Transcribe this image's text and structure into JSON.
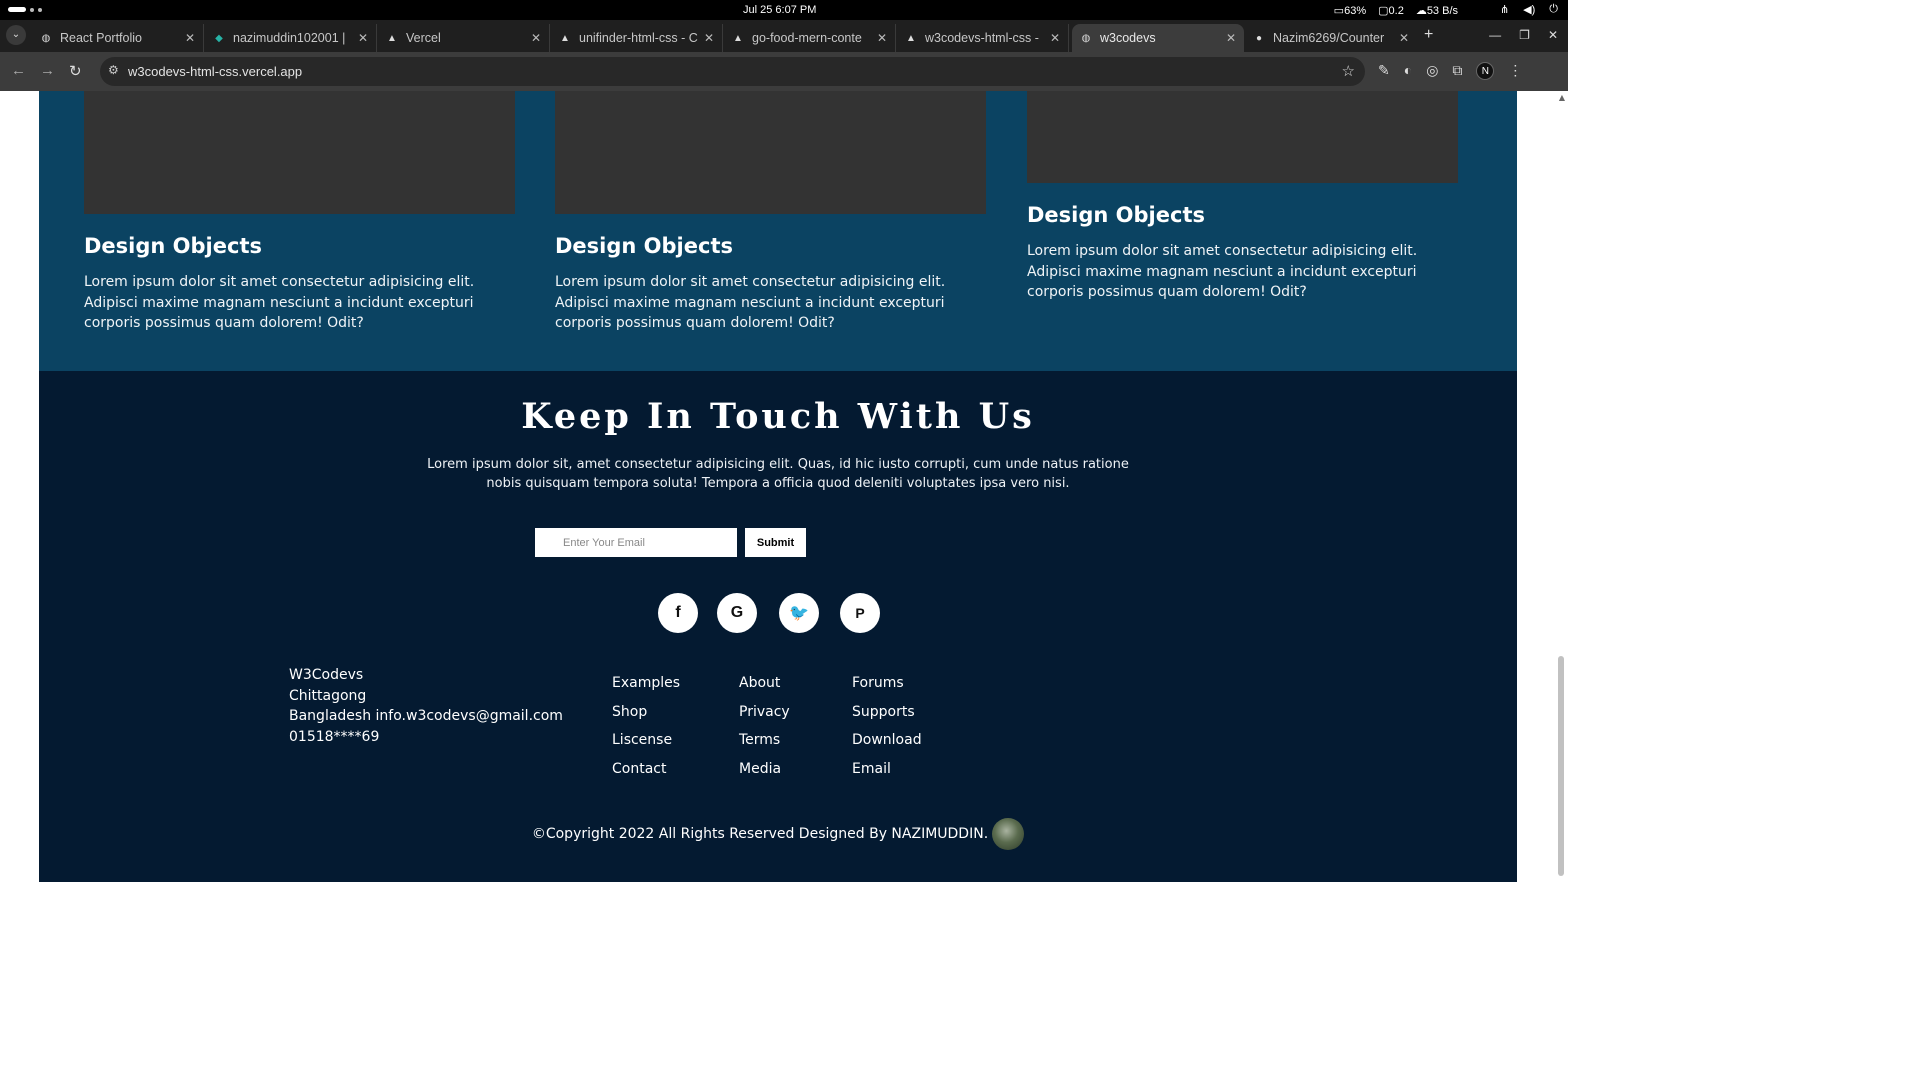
{
  "os": {
    "clock": "Jul 25   6:07 PM",
    "battery": "63%",
    "cpu": "0.2",
    "network": "53 B/s"
  },
  "browser": {
    "tabs": [
      {
        "title": "React Portfolio",
        "icon": "globe-icon"
      },
      {
        "title": "nazimuddin102001 |",
        "icon": "diamond-icon"
      },
      {
        "title": "Vercel",
        "icon": "triangle-icon"
      },
      {
        "title": "unifinder-html-css - C",
        "icon": "triangle-icon"
      },
      {
        "title": "go-food-mern-conte",
        "icon": "triangle-icon"
      },
      {
        "title": "w3codevs-html-css - ",
        "icon": "triangle-icon"
      },
      {
        "title": "w3codevs",
        "icon": "globe-icon",
        "active": true
      },
      {
        "title": "Nazim6269/Counter",
        "icon": "github-icon"
      }
    ],
    "url": "w3codevs-html-css.vercel.app",
    "profile_initial": "N"
  },
  "features": {
    "cards": [
      {
        "title": "Design Objects",
        "text": "Lorem ipsum dolor sit amet consectetur adipisicing elit. Adipisci maxime magnam nesciunt a incidunt excepturi corporis possimus quam dolorem! Odit?"
      },
      {
        "title": "Design Objects",
        "text": "Lorem ipsum dolor sit amet consectetur adipisicing elit. Adipisci maxime magnam nesciunt a incidunt excepturi corporis possimus quam dolorem! Odit?"
      },
      {
        "title": "Design Objects",
        "text": "Lorem ipsum dolor sit amet consectetur adipisicing elit. Adipisci maxime magnam nesciunt a incidunt excepturi corporis possimus quam dolorem! Odit?"
      }
    ]
  },
  "footer": {
    "title": "Keep In Touch With Us",
    "description": "Lorem ipsum dolor sit, amet consectetur adipisicing elit. Quas, id hic iusto corrupti, cum unde natus ratione nobis quisquam tempora soluta! Tempora a officia quod deleniti voluptates ipsa vero nisi.",
    "email_placeholder": "Enter Your Email",
    "submit_label": "Submit",
    "social": [
      {
        "name": "facebook-icon",
        "glyph": "f"
      },
      {
        "name": "google-icon",
        "glyph": "G"
      },
      {
        "name": "twitter-icon",
        "glyph": "🐦"
      },
      {
        "name": "pinterest-icon",
        "glyph": "P"
      }
    ],
    "address": [
      "W3Codevs",
      "Chittagong",
      "Bangladesh info.w3codevs@gmail.com",
      "01518****69"
    ],
    "links": [
      [
        "Examples",
        "Shop",
        "Liscense",
        "Contact"
      ],
      [
        "About",
        "Privacy",
        "Terms",
        "Media"
      ],
      [
        "Forums",
        "Supports",
        "Download",
        "Email"
      ]
    ],
    "copyright": "©Copyright 2022 All Rights Reserved Designed By NAZIMUDDIN."
  }
}
